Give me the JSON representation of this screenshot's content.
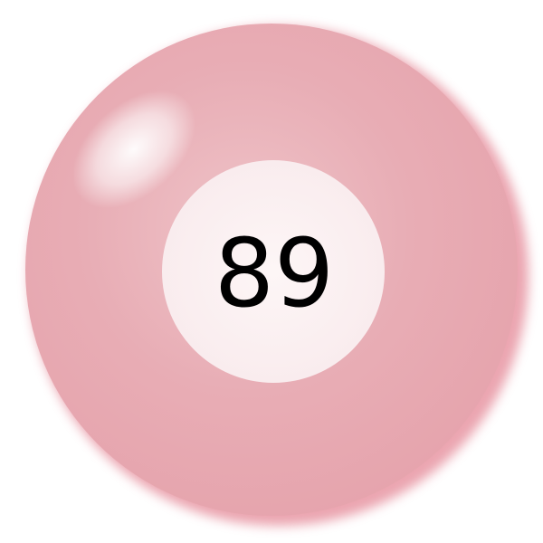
{
  "ball": {
    "number": "89",
    "colors": {
      "body": "#e8adb5",
      "body_light": "#efc3c8",
      "body_shadow": "#e07a8a",
      "center_disc": "#fbf0f1",
      "number_text": "#000000",
      "highlight": "#ffffff"
    }
  }
}
